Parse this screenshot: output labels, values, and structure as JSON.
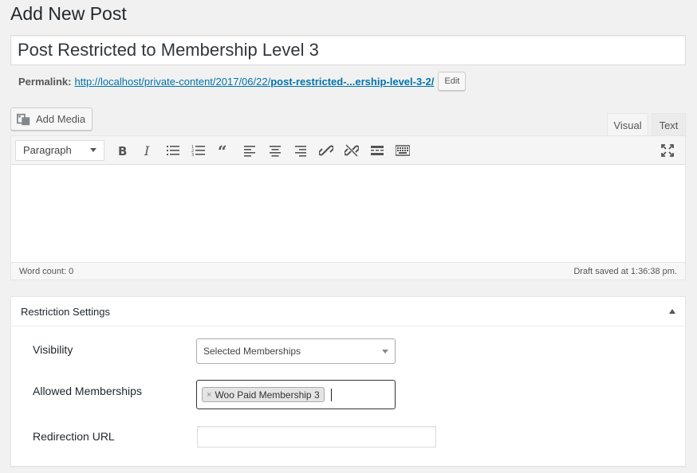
{
  "page": {
    "title": "Add New Post"
  },
  "post": {
    "title_value": "Post Restricted to Membership Level 3",
    "permalink_label": "Permalink:",
    "permalink_base": "http://localhost/private-content/2017/06/22/",
    "permalink_slug": "post-restricted-...ership-level-3-2/",
    "edit_label": "Edit"
  },
  "editor": {
    "add_media_label": "Add Media",
    "tabs": {
      "visual": "Visual",
      "text": "Text"
    },
    "format_select": "Paragraph",
    "toolbar_icons": [
      "bold-icon",
      "italic-icon",
      "bulleted-list-icon",
      "numbered-list-icon",
      "blockquote-icon",
      "align-left-icon",
      "align-center-icon",
      "align-right-icon",
      "insert-link-icon",
      "remove-link-icon",
      "read-more-icon",
      "toolbar-toggle-icon",
      "fullscreen-icon"
    ],
    "word_count": "Word count: 0",
    "draft_status": "Draft saved at 1:36:38 pm."
  },
  "restriction": {
    "title": "Restriction Settings",
    "visibility_label": "Visibility",
    "visibility_value": "Selected Memberships",
    "allowed_label": "Allowed Memberships",
    "allowed_tags": [
      "Woo Paid Membership 3"
    ],
    "tag_remove_glyph": "×",
    "redirect_label": "Redirection URL",
    "redirect_value": ""
  },
  "colors": {
    "link": "#0073aa",
    "background": "#f1f1f1"
  }
}
